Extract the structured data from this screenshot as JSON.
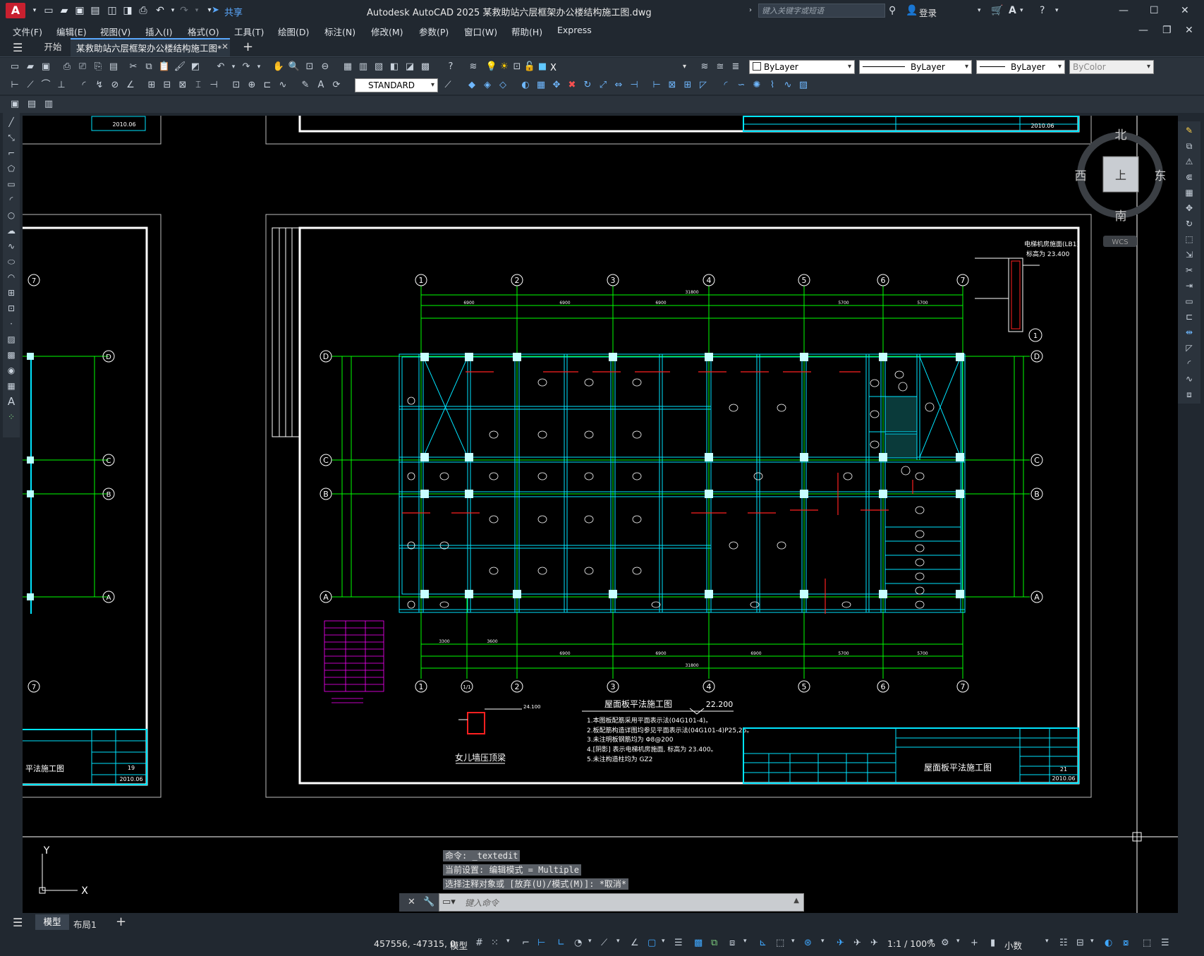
{
  "title_bar": {
    "app_letter": "A",
    "share_label": "共享",
    "window_title": "Autodesk AutoCAD 2025    某救助站六层框架办公楼结构施工图.dwg",
    "search_placeholder": "键入关键字或短语",
    "login_label": "登录"
  },
  "menu": [
    "文件(F)",
    "编辑(E)",
    "视图(V)",
    "插入(I)",
    "格式(O)",
    "工具(T)",
    "绘图(D)",
    "标注(N)",
    "修改(M)",
    "参数(P)",
    "窗口(W)",
    "帮助(H)",
    "Express"
  ],
  "tabs": {
    "start": "开始",
    "document": "某救助站六层框架办公楼结构施工图*"
  },
  "properties": {
    "layer": "X",
    "color": "ByLayer",
    "linetype": "ByLayer",
    "lineweight": "ByLayer",
    "plotstyle": "ByColor",
    "text_style": "STANDARD"
  },
  "viewcube": {
    "north": "北",
    "south": "南",
    "east": "东",
    "west": "西",
    "face": "上",
    "wcs": "WCS"
  },
  "ucs": {
    "x": "X",
    "y": "Y"
  },
  "drawing": {
    "grid_numbers": [
      "1",
      "2",
      "3",
      "4",
      "5",
      "6",
      "7"
    ],
    "grid_extra": "1/1",
    "grid_letters": [
      "D",
      "C",
      "B",
      "A"
    ],
    "top_dims": [
      "6900",
      "6900",
      "6900",
      "5700",
      "5700"
    ],
    "total_dim": "31800",
    "bottom_dims": [
      "3300",
      "3600",
      "6900",
      "6900",
      "6900",
      "5700",
      "5700"
    ],
    "plan_title": "屋面板平法施工图",
    "plan_elevation": "22.200",
    "parapet_title": "女儿墙压顶梁",
    "detail_title": "电梯机房施面(LB1)",
    "detail_elev": "标高为 23.400",
    "detail_mark": "1",
    "notes": [
      "1.本图板配筋采用平面表示法(04G101-4)。",
      "2.板配筋构造详图均参见平面表示法(04G101-4)P25,26。",
      "3.未注明板钢筋均为 Φ8@200",
      "4.[阴影] 表示电梯机房施面, 标高为 23.400。",
      "5.未注构造柱均为 GZ2"
    ],
    "titleblock_name": "屋面板平法施工图",
    "titleblock_date": "2010.06",
    "titleblock_no": "21",
    "left_titleblock_name": "平法施工图",
    "left_titleblock_no": "19",
    "left_titleblock_date": "2010.06"
  },
  "command": {
    "history": [
      "命令: _textedit",
      "当前设置: 编辑模式 = Multiple",
      "选择注释对象或 [放弃(U)/模式(M)]: *取消*"
    ],
    "input_placeholder": "键入命令"
  },
  "layout_tabs": [
    "模型",
    "布局1"
  ],
  "status": {
    "coordinates": "457556, -47315, 0",
    "model_label": "模型",
    "scale": "1:1 / 100%",
    "units": "小数"
  }
}
